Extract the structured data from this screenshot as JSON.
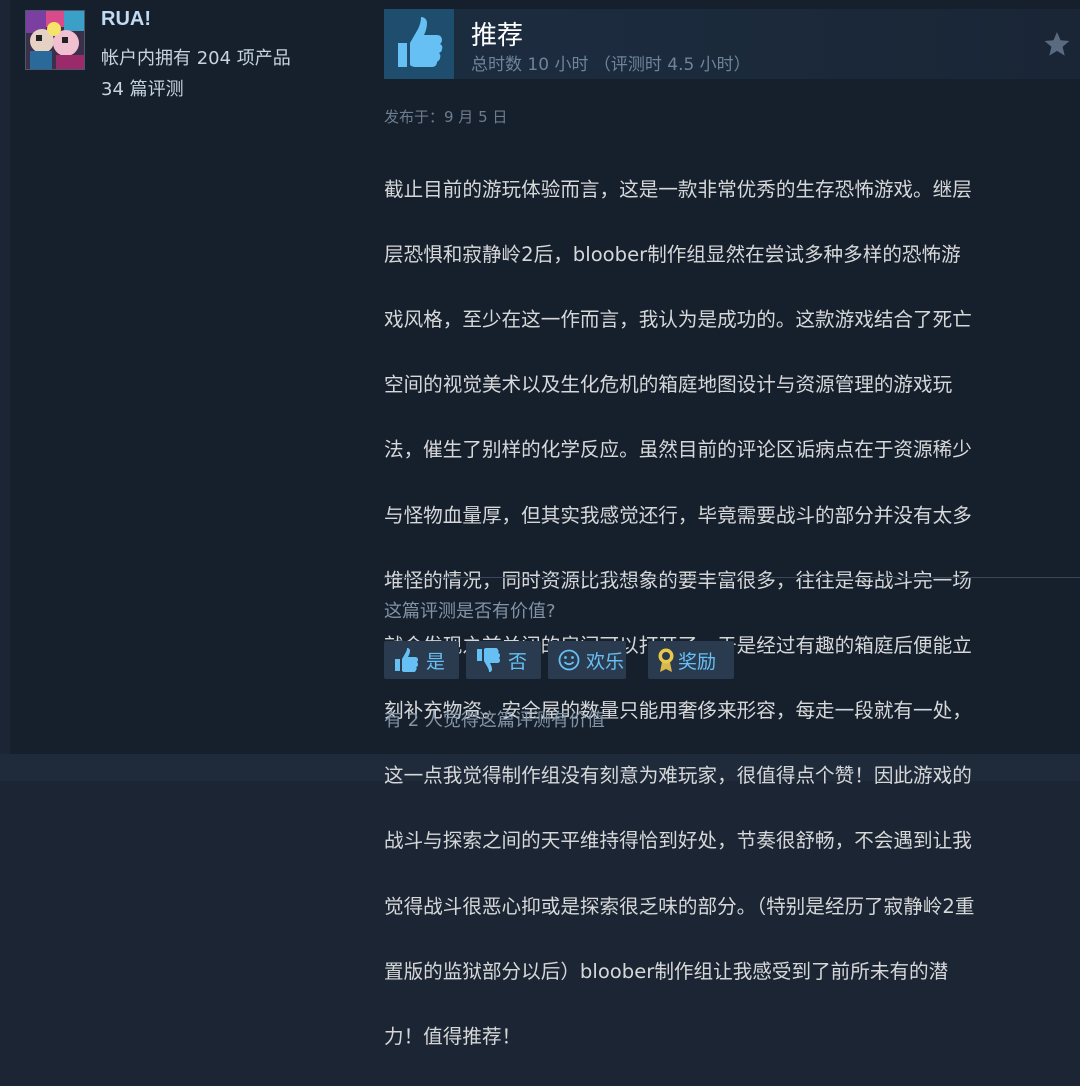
{
  "author": {
    "name": "RUA!",
    "products_owned": "帐户内拥有 204 项产品",
    "review_count": "34 篇评测"
  },
  "review": {
    "recommendation": "推荐",
    "hours": "总时数 10 小时 （评测时 4.5 小时）",
    "posted": "发布于：9 月 5 日",
    "text_lines": [
      "截止目前的游玩体验而言，这是一款非常优秀的生存恐怖游戏。继层",
      "层恐惧和寂静岭2后，bloober制作组显然在尝试多种多样的恐怖游",
      "戏风格，至少在这一作而言，我认为是成功的。这款游戏结合了死亡",
      "空间的视觉美术以及生化危机的箱庭地图设计与资源管理的游戏玩",
      "法，催生了别样的化学反应。虽然目前的评论区诟病点在于资源稀少",
      "与怪物血量厚，但其实我感觉还行，毕竟需要战斗的部分并没有太多",
      "堆怪的情况，同时资源比我想象的要丰富很多，往往是每战斗完一场",
      "就会发现之前关闭的房间可以打开了，于是经过有趣的箱庭后便能立",
      "刻补充物资。安全屋的数量只能用奢侈来形容，每走一段就有一处，",
      "这一点我觉得制作组没有刻意为难玩家，很值得点个赞！因此游戏的",
      "战斗与探索之间的天平维持得恰到好处，节奏很舒畅，不会遇到让我",
      "觉得战斗很恶心抑或是探索很乏味的部分。（特别是经历了寂静岭2重",
      "置版的监狱部分以后）bloober制作组让我感受到了前所未有的潜",
      "力！值得推荐！"
    ]
  },
  "feedback": {
    "question": "这篇评测是否有价值?",
    "yes_label": "是",
    "no_label": "否",
    "funny_label": "欢乐",
    "award_label": "奖励",
    "helpful_count": "有 2 人觉得这篇评测有价值"
  },
  "icons": {
    "thumbs_up": "thumbs-up-icon",
    "star": "star-icon",
    "vote_up": "thumbs-up-icon",
    "vote_down": "thumbs-down-icon",
    "funny": "smiley-icon",
    "award": "award-ribbon-icon"
  },
  "colors": {
    "background": "#16202d",
    "accent": "#66c0f4",
    "thumb_box": "#1f4d6e",
    "button_bg": "#2a3a4f"
  }
}
